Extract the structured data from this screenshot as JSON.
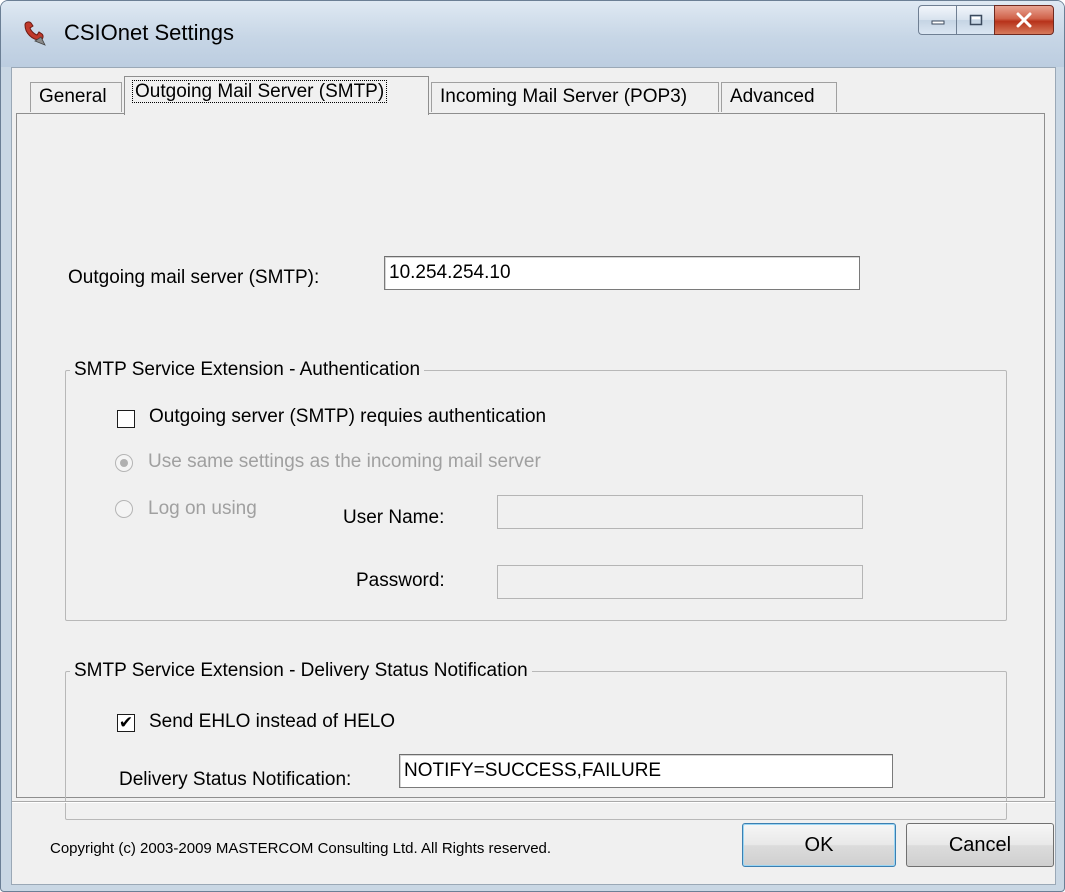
{
  "window": {
    "title": "CSIOnet Settings"
  },
  "tabs": [
    {
      "label": "General",
      "selected": false
    },
    {
      "label": "Outgoing Mail Server (SMTP)",
      "selected": true
    },
    {
      "label": "Incoming Mail Server (POP3)",
      "selected": false
    },
    {
      "label": "Advanced",
      "selected": false
    }
  ],
  "smtp": {
    "server_label": "Outgoing mail server (SMTP):",
    "server_value": "10.254.254.10"
  },
  "auth_group": {
    "title": "SMTP Service Extension - Authentication",
    "requires_auth_label": "Outgoing server (SMTP) requies authentication",
    "requires_auth_checked": false,
    "same_settings_label": "Use same settings as the incoming mail server",
    "same_settings_selected": true,
    "logon_label": "Log on using",
    "logon_selected": false,
    "username_label": "User Name:",
    "username_value": "",
    "password_label": "Password:",
    "password_value": ""
  },
  "dsn_group": {
    "title": "SMTP Service Extension - Delivery Status Notification",
    "ehlo_label": "Send EHLO instead of HELO",
    "ehlo_checked": true,
    "ehlo_mark": "✔",
    "dsn_label": "Delivery Status Notification:",
    "dsn_value": "NOTIFY=SUCCESS,FAILURE"
  },
  "footer": {
    "copyright": "Copyright (c) 2003-2009 MASTERCOM Consulting Ltd. All Rights reserved.",
    "ok_label": "OK",
    "cancel_label": "Cancel"
  },
  "icons": {
    "app": "phone-handset-icon",
    "minimize": "minimize-icon",
    "maximize": "maximize-icon",
    "close": "close-icon"
  },
  "colors": {
    "titlebar": "#c7d6e6",
    "client_bg": "#f0f0f0",
    "close_button": "#c44a30",
    "disabled_text": "#a0a0a0"
  }
}
